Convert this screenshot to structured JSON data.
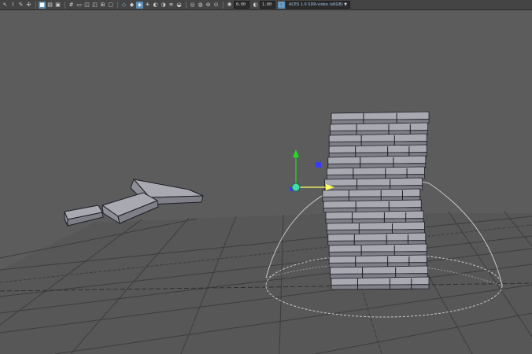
{
  "toolbar": {
    "icons": [
      "select-tool-icon",
      "lasso-tool-icon",
      "paint-select-icon",
      "move-tool-icon",
      "camera-icon",
      "bookmark-icon",
      "image-plane-icon",
      "grid-icon",
      "film-gate-icon",
      "resolution-gate-icon",
      "gate-mask-icon",
      "field-chart-icon",
      "safe-action-icon",
      "wireframe-icon",
      "smooth-shade-icon",
      "textured-icon",
      "lights-icon",
      "shadows-icon",
      "ambient-occlusion-icon",
      "motion-blur-icon",
      "anti-alias-icon",
      "isolate-select-icon",
      "xray-icon",
      "xray-joints-icon",
      "backface-icon",
      "exposure-icon",
      "gamma-icon"
    ],
    "exposure_value": "0.00",
    "gamma_value": "1.00",
    "color_space": "ACES 1.0 SDR-video (sRGB)"
  },
  "colors": {
    "toolbar_bg": "#444444",
    "viewport_bg": "#5c5c5c",
    "grid_line": "#3d3d3d",
    "grid_axis": "#2f2f2f",
    "block_top": "#a9a9b1",
    "block_side": "#7f7f88",
    "block_edge": "#1d1d26",
    "manipulator_x": "#ffff66",
    "manipulator_y": "#22dd22",
    "manipulator_z": "#3a3aff",
    "manipulator_center": "#44ddaa",
    "light_cone": "#c8c8c8"
  },
  "scene": {
    "tower_rows": 16,
    "fallen_blocks": 3
  }
}
